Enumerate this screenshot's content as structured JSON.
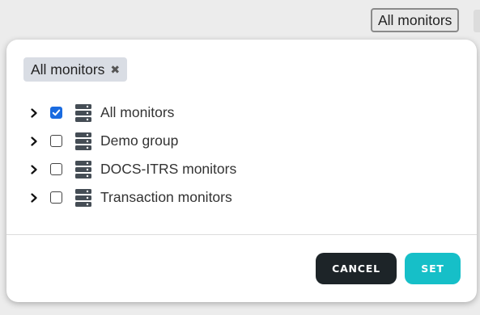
{
  "top": {
    "selector_label": "All monitors"
  },
  "chips": [
    {
      "label": "All monitors",
      "remove_icon": "close-icon"
    }
  ],
  "tree": {
    "items": [
      {
        "label": "All monitors",
        "checked": true,
        "icon": "server-icon",
        "expand_icon": "chevron-right-icon"
      },
      {
        "label": "Demo group",
        "checked": false,
        "icon": "server-icon",
        "expand_icon": "chevron-right-icon"
      },
      {
        "label": "DOCS-ITRS monitors",
        "checked": false,
        "icon": "server-icon",
        "expand_icon": "chevron-right-icon"
      },
      {
        "label": "Transaction monitors",
        "checked": false,
        "icon": "server-icon",
        "expand_icon": "chevron-right-icon"
      }
    ]
  },
  "actions": {
    "cancel_label": "CANCEL",
    "set_label": "SET"
  },
  "colors": {
    "checkbox_checked": "#1a6be0",
    "cancel_bg": "#1d2428",
    "set_bg": "#16bfc8",
    "chip_bg": "#d9dde4"
  }
}
